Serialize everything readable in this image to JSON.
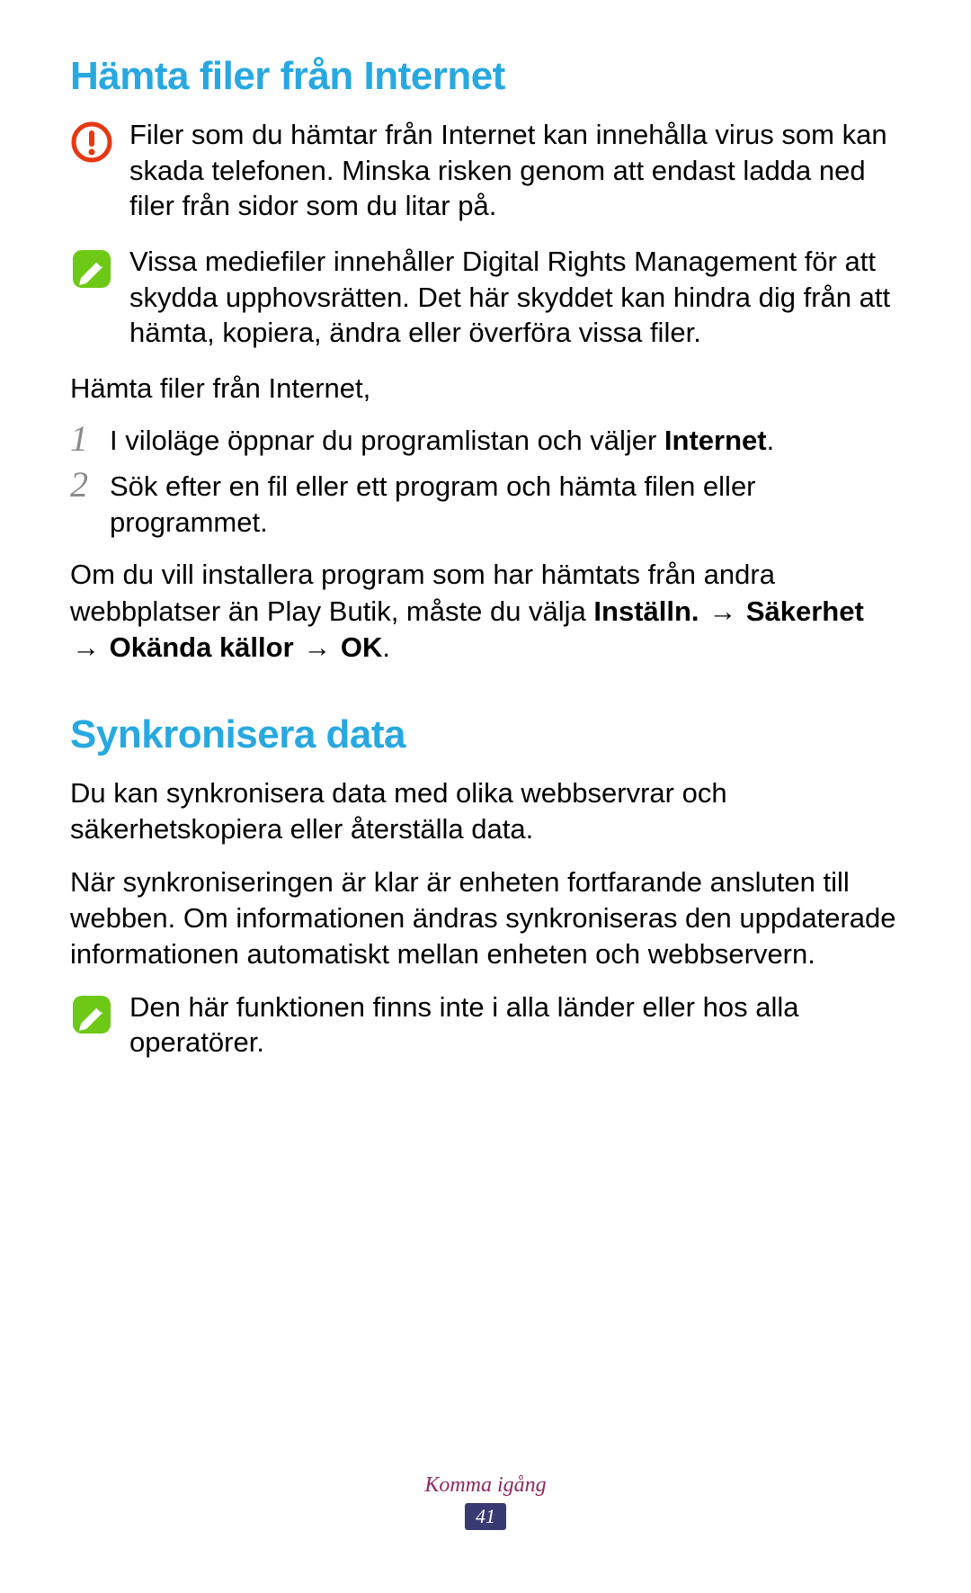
{
  "section1": {
    "title": "Hämta filer från Internet",
    "warning_text": "Filer som du hämtar från Internet kan innehålla virus som kan skada telefonen. Minska risken genom att endast ladda ned filer från sidor som du litar på.",
    "note1_text": "Vissa mediefiler innehåller Digital Rights Management för att skydda upphovsrätten. Det här skyddet kan hindra dig från att hämta, kopiera, ändra eller överföra vissa filer.",
    "intro": "Hämta filer från Internet,",
    "step1_pre": "I viloläge öppnar du programlistan och väljer ",
    "step1_bold": "Internet",
    "step1_post": ".",
    "step2": "Sök efter en fil eller ett program och hämta filen eller programmet.",
    "install_pre": "Om du vill installera program som har hämtats från andra webbplatser än Play Butik, måste du välja ",
    "install_b1": "Inställn.",
    "install_b2": "Säkerhet",
    "install_b3": "Okända källor",
    "install_b4": "OK",
    "arrow": "→"
  },
  "section2": {
    "title": "Synkronisera data",
    "p1": "Du kan synkronisera data med olika webbservrar och säkerhetskopiera eller återställa data.",
    "p2": "När synkroniseringen är klar är enheten fortfarande ansluten till webben. Om informationen ändras synkroniseras den uppdaterade informationen automatiskt mellan enheten och webbservern.",
    "note_text": "Den här funktionen finns inte i alla länder eller hos alla operatörer."
  },
  "footer": {
    "section_label": "Komma igång",
    "page_number": "41"
  },
  "icons": {
    "warning": "warning-icon",
    "note": "note-icon"
  }
}
